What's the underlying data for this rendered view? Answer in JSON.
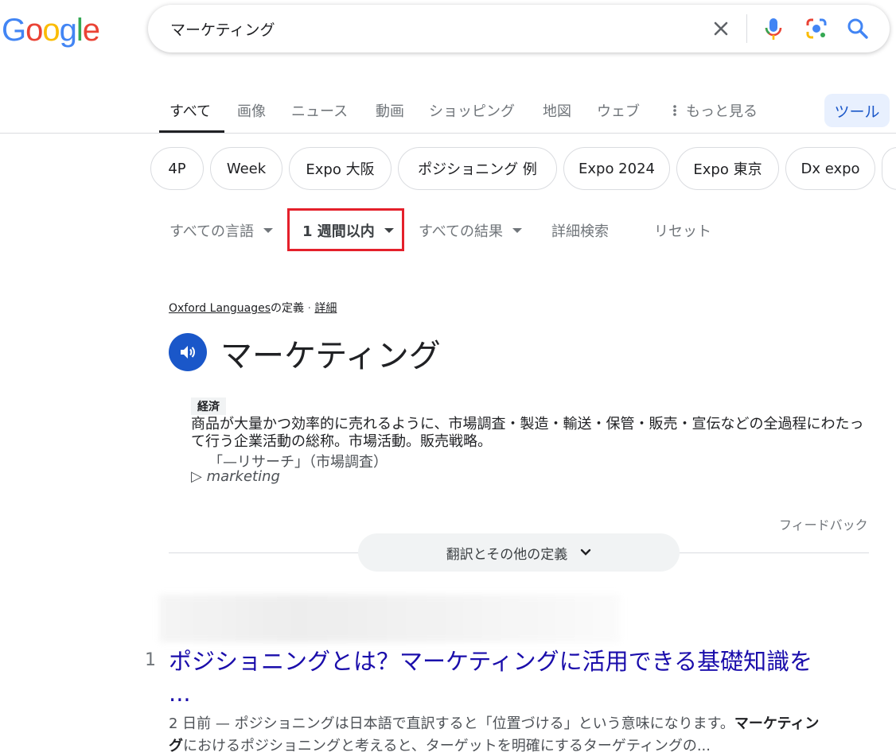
{
  "logo": {
    "letters": [
      "G",
      "o",
      "o",
      "g",
      "l",
      "e"
    ],
    "colors": [
      "#4285f4",
      "#ea4335",
      "#fbbc05",
      "#4285f4",
      "#34a853",
      "#ea4335"
    ]
  },
  "search": {
    "query": "マーケティング",
    "icons": [
      "close-icon",
      "mic-icon",
      "lens-icon",
      "search-icon"
    ]
  },
  "tabs": {
    "items": [
      "すべて",
      "画像",
      "ニュース",
      "動画",
      "ショッピング",
      "地図",
      "ウェブ"
    ],
    "more": "もっと見る",
    "active": "すべて",
    "tools": "ツール"
  },
  "chips": [
    "4P",
    "Week",
    "Expo 大阪",
    "ポジショニング 例",
    "Expo 2024",
    "Expo 東京",
    "Dx expo"
  ],
  "filters": {
    "language": "すべての言語",
    "time": "1 週間以内",
    "results": "すべての結果",
    "advanced": "詳細検索",
    "reset": "リセット"
  },
  "dictionary": {
    "source": "Oxford Languages",
    "source_suffix": "の定義",
    "separator": "·",
    "details_link": "詳細",
    "headword": "マーケティング",
    "label": "経済",
    "definition": "商品が大量かつ効率的に売れるように、市場調査・製造・輸送・保管・販売・宣伝などの全過程にわたって行う企業活動の総称。市場活動。販売戦略。",
    "example": "「—リサーチ」（市場調査）",
    "translation_marker": "▷",
    "translation": "marketing",
    "feedback": "フィードバック",
    "more_button": "翻訳とその他の定義"
  },
  "result": {
    "number": "1",
    "title": "ポジショニングとは？マーケティングに活用できる基礎知識を ...",
    "snippet_date": "2 日前",
    "snippet_dash": " — ",
    "snippet_part1": "ポジショニングは日本語で直訳すると「位置づける」という意味になります。",
    "snippet_bold1": "マーケティング",
    "snippet_part2": "におけるポジショニングと考えると、ターゲットを明確にするターゲティングの..."
  },
  "colors": {
    "accent_blue": "#1a57c9",
    "link": "#1a0dab",
    "highlight_red": "#e4202b",
    "tools_bg": "#e8f0fe"
  }
}
